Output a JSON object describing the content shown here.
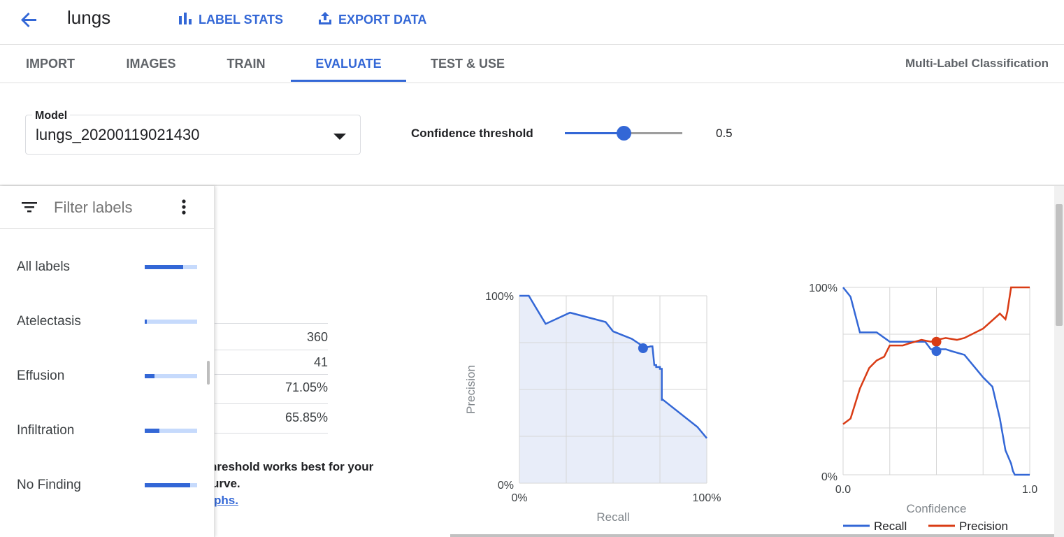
{
  "header": {
    "title": "lungs",
    "actions": [
      {
        "label": "LABEL STATS",
        "icon": "bar-chart-icon"
      },
      {
        "label": "EXPORT DATA",
        "icon": "upload-icon"
      }
    ]
  },
  "tabs": [
    {
      "label": "IMPORT"
    },
    {
      "label": "IMAGES"
    },
    {
      "label": "TRAIN"
    },
    {
      "label": "EVALUATE",
      "active": true
    },
    {
      "label": "TEST & USE"
    }
  ],
  "mode": "Multi-Label Classification",
  "model": {
    "legend": "Model",
    "value": "lungs_20200119021430"
  },
  "confidence": {
    "label": "Confidence threshold",
    "value": "0.5",
    "level": 0.5
  },
  "filter": {
    "placeholder": "Filter labels"
  },
  "labels": [
    {
      "name": "All labels",
      "fill": 0.73
    },
    {
      "name": "Atelectasis",
      "fill": 0.04
    },
    {
      "name": "Effusion",
      "fill": 0.18
    },
    {
      "name": "Infiltration",
      "fill": 0.28
    },
    {
      "name": "No Finding",
      "fill": 0.86
    }
  ],
  "metrics": [
    "360",
    "41",
    "71.05%",
    "65.85%"
  ],
  "info": {
    "line1": "hreshold works best for your",
    "line2": "urve.",
    "link": "phs."
  },
  "colors": {
    "accent": "#3367d6",
    "precision": "#d93c15",
    "fill": "#e8edf9"
  },
  "chart_data": [
    {
      "type": "area",
      "xlabel": "Recall",
      "ylabel": "Precision",
      "xticks": [
        "0%",
        "100%"
      ],
      "yticks": [
        "0%",
        "100%"
      ],
      "xlim": [
        0,
        1
      ],
      "ylim": [
        0,
        1
      ],
      "grid": true,
      "series": [
        {
          "x": [
            0,
            0.05,
            0.14,
            0.27,
            0.46,
            0.5,
            0.6,
            0.66,
            0.66,
            0.7,
            0.71,
            0.72,
            0.73,
            0.73,
            0.75,
            0.75,
            0.76,
            0.76,
            0.76,
            0.95,
            1.0
          ],
          "y": [
            1.0,
            1.0,
            0.85,
            0.91,
            0.86,
            0.81,
            0.77,
            0.73,
            0.72,
            0.73,
            0.73,
            0.63,
            0.63,
            0.62,
            0.62,
            0.61,
            0.61,
            0.44,
            0.45,
            0.3,
            0.24
          ]
        }
      ],
      "marker": {
        "x": 0.66,
        "y": 0.72
      }
    },
    {
      "type": "line",
      "xlabel": "Confidence",
      "ylabel": "",
      "xticks": [
        "0.0",
        "1.0"
      ],
      "yticks": [
        "0%",
        "100%"
      ],
      "xlim": [
        0,
        1
      ],
      "ylim": [
        0,
        1
      ],
      "grid": true,
      "legend_position": "bottom",
      "series": [
        {
          "name": "Recall",
          "color": "#3367d6",
          "x": [
            0,
            0.04,
            0.09,
            0.18,
            0.25,
            0.44,
            0.47,
            0.5,
            0.55,
            0.58,
            0.65,
            0.7,
            0.75,
            0.8,
            0.84,
            0.87,
            0.9,
            0.91,
            0.92,
            0.94,
            1.0
          ],
          "y": [
            1.0,
            0.95,
            0.76,
            0.76,
            0.71,
            0.71,
            0.67,
            0.67,
            0.67,
            0.66,
            0.64,
            0.58,
            0.52,
            0.47,
            0.3,
            0.13,
            0.06,
            0.02,
            0.0,
            0.0,
            0.0
          ]
        },
        {
          "name": "Precision",
          "color": "#d93c15",
          "x": [
            0,
            0.04,
            0.09,
            0.14,
            0.18,
            0.22,
            0.25,
            0.32,
            0.35,
            0.42,
            0.47,
            0.5,
            0.55,
            0.61,
            0.65,
            0.75,
            0.84,
            0.87,
            0.88,
            0.9,
            0.93,
            1.0
          ],
          "y": [
            0.27,
            0.3,
            0.46,
            0.57,
            0.61,
            0.63,
            0.69,
            0.69,
            0.7,
            0.72,
            0.71,
            0.72,
            0.73,
            0.72,
            0.73,
            0.78,
            0.86,
            0.83,
            0.87,
            1.0,
            1.0,
            1.0
          ]
        }
      ],
      "markers": [
        {
          "series": "Precision",
          "x": 0.5,
          "y": 0.71
        },
        {
          "series": "Recall",
          "x": 0.5,
          "y": 0.66
        }
      ]
    }
  ]
}
